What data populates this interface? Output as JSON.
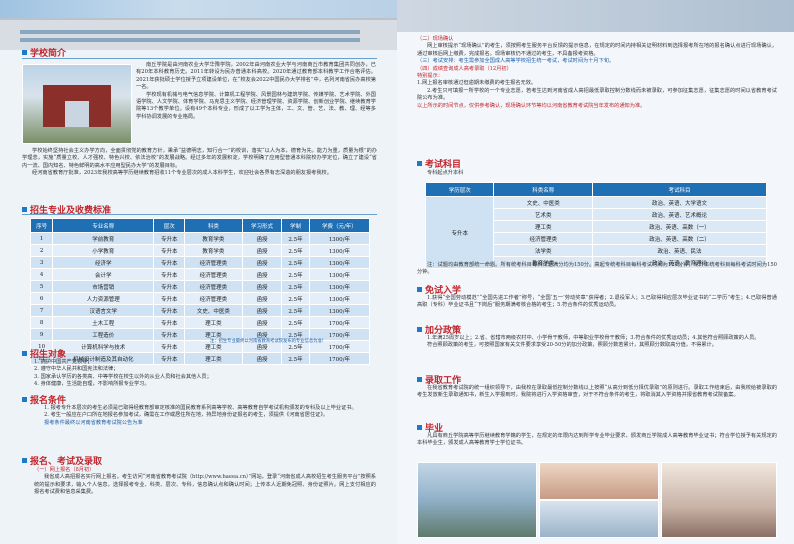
{
  "banner": {
    "sign": "南 者 馆"
  },
  "intro": {
    "heading": "学校简介",
    "p1": "南丘学院是由河南农业大学华豫学院，2002年由河南农业大学与河南商丘市教育集团共同创办，已有20年本科教育历史。2011年转设为民办普通本科高校。2020年通过教育部本科教学工作合格评估。2021年获批硕士学位授予立项建设单位，在“校友会2022中国民办大学排名”中，名列河南省民办高校第一名。",
    "p2": "学校现有机械与电气信息学院、计算机工程学院、风景园林与建筑学院、传媒学院、艺术学院、外国语学院、人文学院、体育学院、马克思主义学院、经济管理学院、资源学院、创新创业学院、继续教育学院等13个教学单位。设有49个本科专业，形成了以工学为主体，工、文、管、艺、法、教、理、经等多学科协调发展的专业格局。",
    "p3": "学校始终坚持社会主义办学方向，全面贯彻党的教育方针，秉承“益德明志，知行合一”的校训，落实“以人为本，德育为先，能力为重，质量为根”的办学理念，实施“质量立校、人才强校、特色兴校、依法治校”的发展战略。经过多年的发展积淀，学校明确了应用型普通本科院校办学定位，确立了建设“省内一流、国内知名、特色鲜明的高水平应用型民办大学”的发展目标。",
    "p4": "经河南省教育厅批准，2023年我校高等学历继续教育招收11个专业层次的成人本科学生，欢迎社会各界有志深造的朋友报考我校。"
  },
  "majors": {
    "heading": "招生专业及收费标准",
    "headers": [
      "序号",
      "专业名称",
      "层次",
      "科类",
      "学习形式",
      "学制",
      "学费（元/年）"
    ],
    "rows": [
      [
        "1",
        "学前教育",
        "专升本",
        "教育学类",
        "函授",
        "2.5年",
        "1300/年"
      ],
      [
        "2",
        "小学教育",
        "专升本",
        "教育学类",
        "函授",
        "2.5年",
        "1300/年"
      ],
      [
        "3",
        "经济学",
        "专升本",
        "经济管理类",
        "函授",
        "2.5年",
        "1300/年"
      ],
      [
        "4",
        "会计学",
        "专升本",
        "经济管理类",
        "函授",
        "2.5年",
        "1300/年"
      ],
      [
        "5",
        "市场营销",
        "专升本",
        "经济管理类",
        "函授",
        "2.5年",
        "1300/年"
      ],
      [
        "6",
        "人力资源管理",
        "专升本",
        "经济管理类",
        "函授",
        "2.5年",
        "1300/年"
      ],
      [
        "7",
        "汉语言文学",
        "专升本",
        "文史、中医类",
        "函授",
        "2.5年",
        "1300/年"
      ],
      [
        "8",
        "土木工程",
        "专升本",
        "理工类",
        "函授",
        "2.5年",
        "1700/年"
      ],
      [
        "9",
        "工程造价",
        "专升本",
        "理工类",
        "函授",
        "2.5年",
        "1700/年"
      ],
      [
        "10",
        "计算机科学与技术",
        "专升本",
        "理工类",
        "函授",
        "2.5年",
        "1700/年"
      ],
      [
        "11",
        "机械设计制造及其自动化",
        "专升本",
        "理工类",
        "函授",
        "2.5年",
        "1700/年"
      ]
    ],
    "note": "注：招生专业最终以河南省教育考试院发布的专业信息为准！"
  },
  "targets": {
    "heading": "招生对象",
    "items": [
      "1. 拥护中国共产党领导；",
      "2. 遵守中华人民共和国宪法和法律；",
      "3. 国家承认学历的各类高、中等学校在校生以外的从业人员和社会其他人员；",
      "4. 身体健康，生活能自理，不影响所报专业学习。"
    ]
  },
  "qualify": {
    "heading": "报名条件",
    "p1": "1. 报考专升本层次的考生必须是已取得经教育部审定核准的国民教育系列高等学校、高等教育自学考试机构颁发的专科及以上毕业证书。",
    "p2": "2. 考生一般应在户口所在地报名参加考试，确需在工作或居住所在地，持异地身份证报名的考生，须提供《河南省居住证》。",
    "p3": "报考条件最终以河南省教育考试院公告为准"
  },
  "signup": {
    "heading": "报名、考试及录取",
    "sub": "（一）网上报名（8月初）",
    "p": "我省成人高招报名实行网上报名。考生访问“河南省教育考试院（http://www.haeea.cn）”网站，登录“河南省成人高校招生考生服务平台”按照系统的提示和要求，输入个人信息，选择报考专业、科类、层次、专科，信息确认点和确认时间；上传本人近期免冠照、身份证照片。网上支付相应的报名考试费和信息采集费。"
  },
  "confirm": {
    "sub": "（二）现场确认",
    "p": "网上审核提示“现场确认”的考生，须按照考生服务平台反馈的提示信息，在规定的时间内持相关证明材料到选择报考所在地的报名确认点进行现场确认，通过审核后网上缴费，完成报名。现场审核仍不通过的考生，不具备报考资格。",
    "sub3": "（三）考试安排：考生需参加全国成人高等学校招生统一考试，考试时间为十月下旬。",
    "sub4": "（四）成绩查询成人高考录取（12月初）",
    "tip_h": "特别提示：",
    "tip1": "1.网上报名审核通过但逾期未缴费的考生报名无效。",
    "tip2": "2.考生只可填报一所学校的一个专业志愿，若考生达到河南省成人高招最低录取控制分数线而未被录取，可参加征集志愿，征集志愿的时间以省教育考试院公布为准。",
    "tip3": "以上所示的时间节点，仅供参考确认，现场确认环节等均以河南省教育考试院当年发布的通知为准。"
  },
  "subjects": {
    "heading": "考试科目",
    "intro": "专科起点升本科",
    "headers": [
      "学历层次",
      "科类名称",
      "考试科目"
    ],
    "level": "专升本",
    "rows": [
      [
        "文史、中医类",
        "政治、英语、大学语文"
      ],
      [
        "艺术类",
        "政治、英语、艺术概论"
      ],
      [
        "理工类",
        "政治、英语、高数（一）"
      ],
      [
        "经济管理类",
        "政治、英语、高数（二）"
      ],
      [
        "法学类",
        "政治、英语、民法"
      ],
      [
        "教育学类",
        "政治、英语、教育理论"
      ]
    ],
    "note": "注：试题均由教育部统一命题。所有统考科目每科试题满分均为150分。高起专统考科目每科考试时间为120分钟，专升本统考科目每科考试时间为150分钟。"
  },
  "exempt": {
    "heading": "免试入学",
    "p1": "1.获得“全国劳动模范”“全国先进工作者”称号，“全国‘五一’劳动奖章”获得者；2.退役军人；3.已取得相应层次毕业证书的“二学历”考生；4.已取得普通高职（专科）毕业证书且“下岗后”服务期满考核合格的考生；5.符合条件的优秀运动员。"
  },
  "bonus": {
    "heading": "加分政策",
    "p1": "1.年满25周岁以上；2.省、省辖市两级农村中、小学骨干教师，中等职业学校骨干教师；3.符合条件的优秀运动员；4.其他符合照顾政策的人员。",
    "p2": "符合照顾政策的考生，可按照国家有关文件要求享受20-50分的加分政策，照顾分数若累计，其照顾分数取高分值，不得累计。"
  },
  "admit": {
    "heading": "录取工作",
    "p": "在我省教育考试院的统一组织领导下，由我校在录取最低控制分数线以上按照“从高分到低分择优录取”的原则进行。录取工作结束后，由我校给被录取的考生发放新生录取通知书，新生入学报到时，我院将进行入学资格审查，对于不符合条件的考生，将取消其入学资格并报省教育考试院备案。"
  },
  "grad": {
    "heading": "毕业",
    "p": "凡具有商丘学院高等学历继续教育学籍的学生，在规定的年限内达到所学专业毕业要求，颁发商丘学院成人高等教育毕业证书；符合学位授予有关规定的本科毕业生，颁发成人高等教育学士学位证书。"
  },
  "colors": {
    "accent": "#c0262d",
    "blue": "#1f6fb5"
  }
}
